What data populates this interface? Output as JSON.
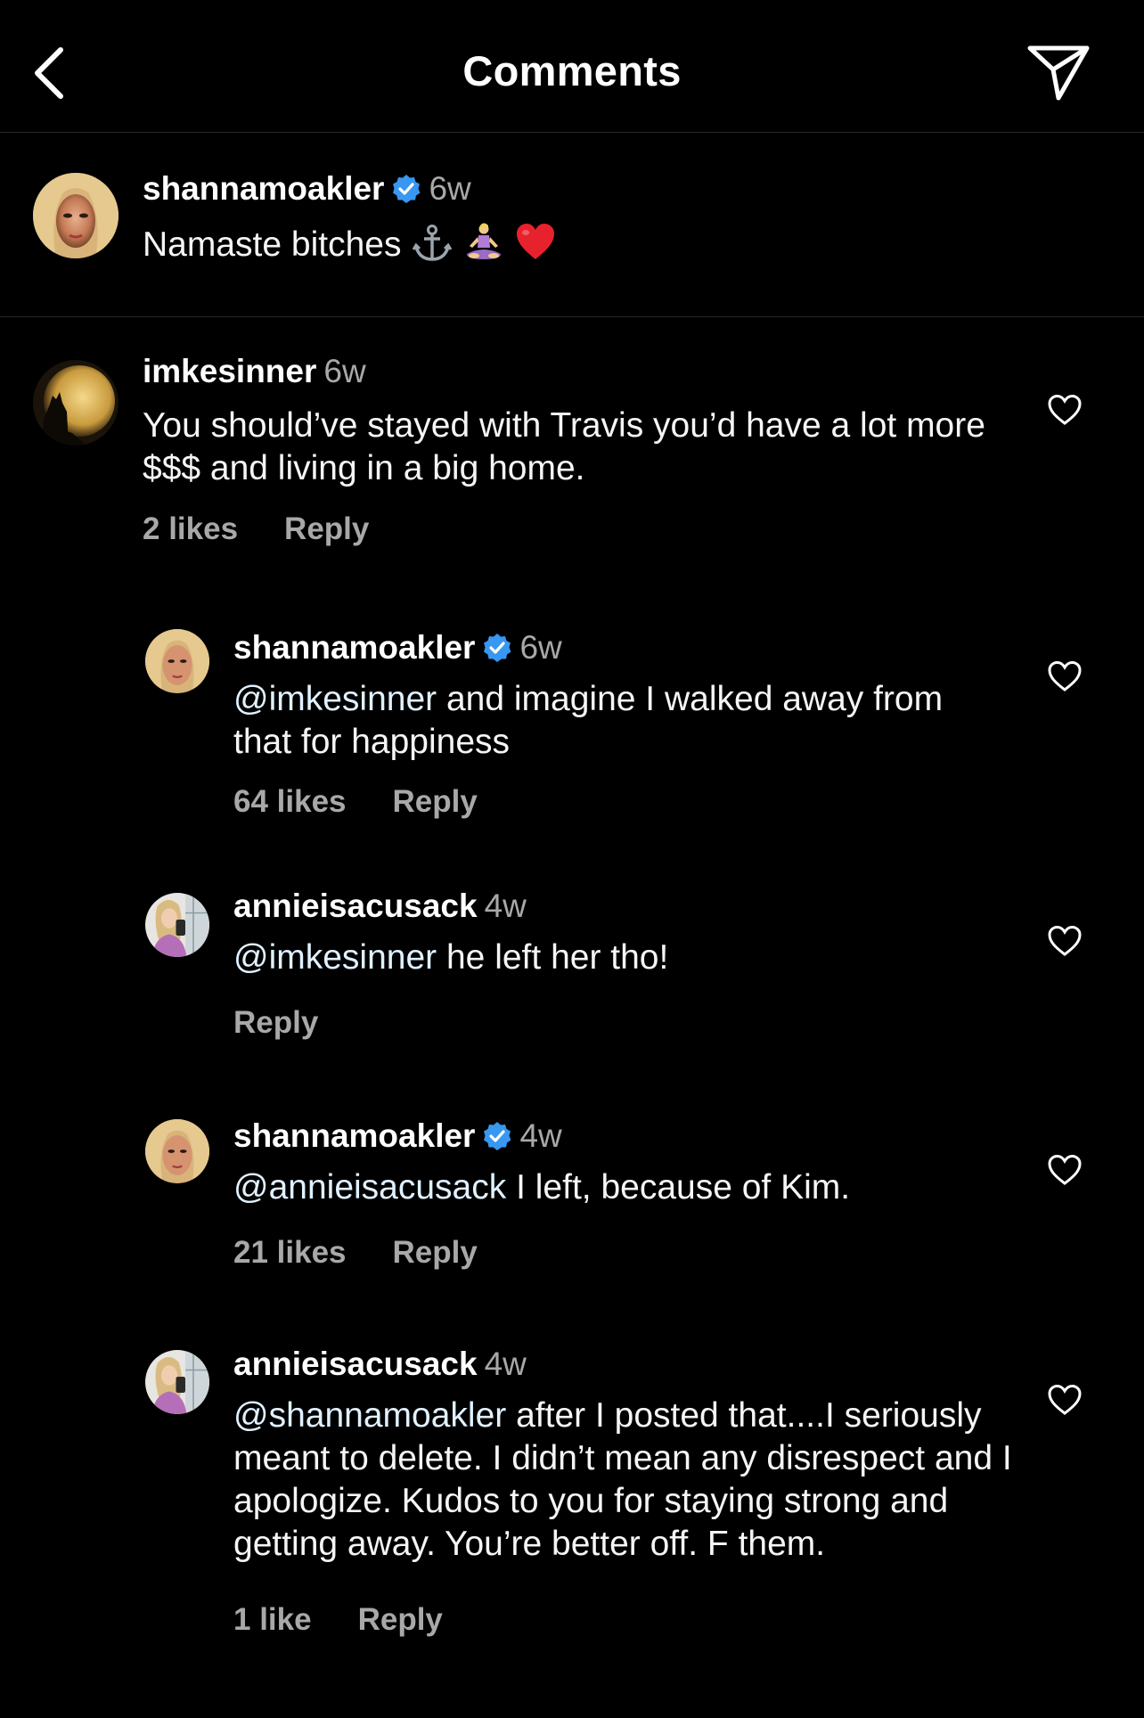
{
  "header": {
    "title": "Comments",
    "back_icon": "chevron-left-icon",
    "share_icon": "paper-plane-icon"
  },
  "caption": {
    "username": "shannamoakler",
    "verified": true,
    "time": "6w",
    "text": "Namaste bitches",
    "emojis": [
      "anchor",
      "person-in-lotus-position",
      "red-heart"
    ]
  },
  "comments": [
    {
      "username": "imkesinner",
      "verified": false,
      "time": "6w",
      "text": "You should’ve stayed with Travis you’d have a lot more $$$ and living in a big home.",
      "likes": "2 likes",
      "reply": "Reply"
    },
    {
      "username": "shannamoakler",
      "verified": true,
      "time": "6w",
      "mention": "@imkesinner",
      "text": " and imagine I walked away from that for happiness",
      "likes": "64 likes",
      "reply": "Reply"
    },
    {
      "username": "annieisacusack",
      "verified": false,
      "time": "4w",
      "mention": "@imkesinner",
      "text": " he left her tho!",
      "likes": "",
      "reply": "Reply"
    },
    {
      "username": "shannamoakler",
      "verified": true,
      "time": "4w",
      "mention": "@annieisacusack",
      "text": " I left, because of Kim.",
      "likes": "21 likes",
      "reply": "Reply"
    },
    {
      "username": "annieisacusack",
      "verified": false,
      "time": "4w",
      "mention": "@shannamoakler",
      "text": " after I posted that....I seriously meant to delete. I didn’t mean any disrespect and I apologize. Kudos to you for staying strong and getting away. You’re better off. F them.",
      "likes": "1 like",
      "reply": "Reply"
    }
  ],
  "colors": {
    "background": "#000000",
    "text": "#ffffff",
    "secondary": "#a8a8a8",
    "verified_badge": "#3897f0",
    "divider": "#262626"
  }
}
